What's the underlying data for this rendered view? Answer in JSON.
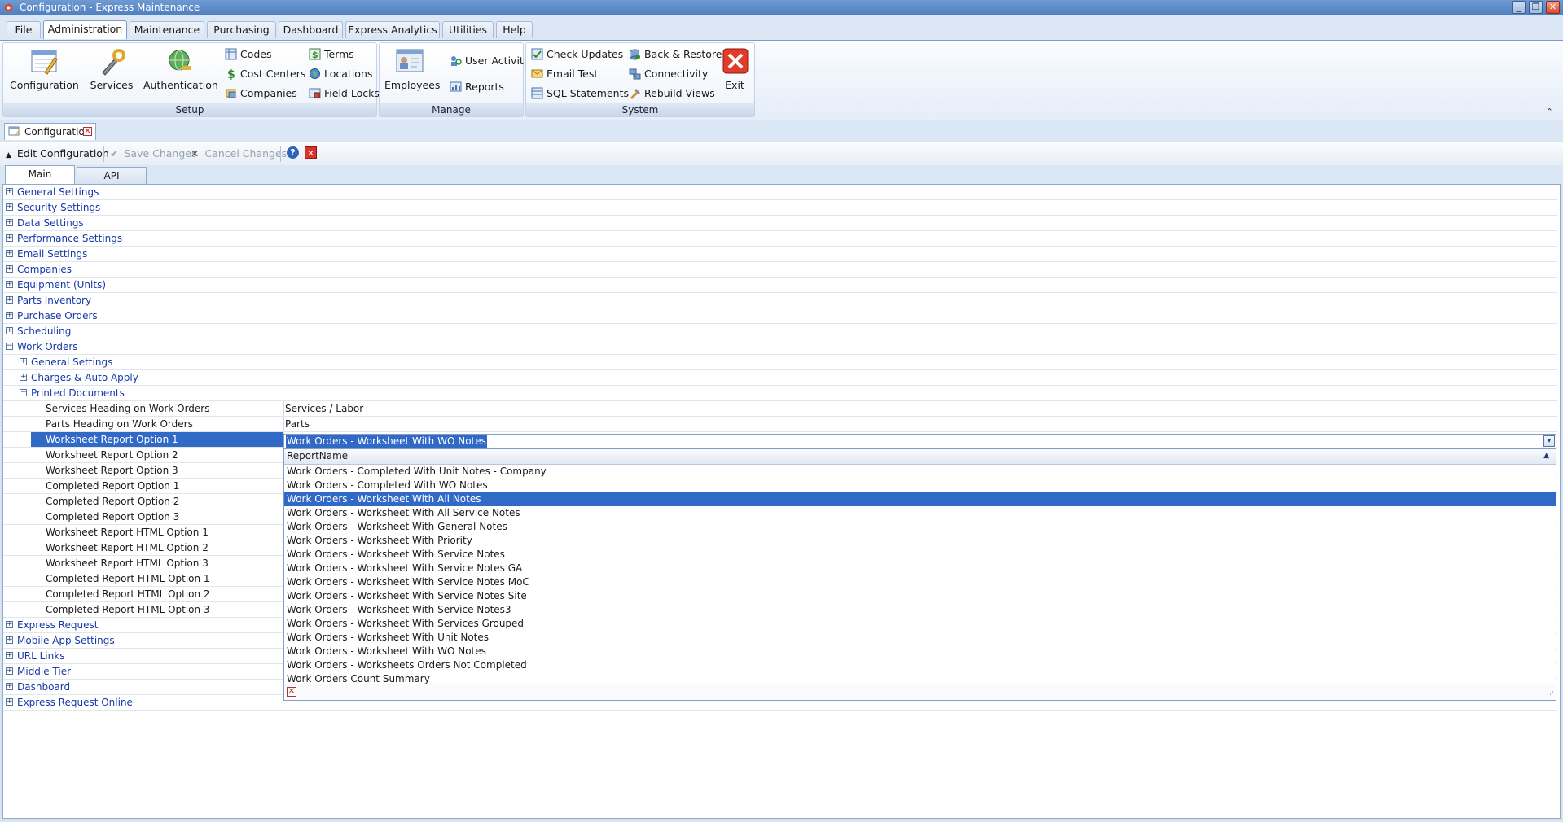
{
  "window": {
    "title": "Configuration - Express Maintenance",
    "minimize_glyph": "_",
    "restore_glyph": "❐",
    "close_glyph": "✕"
  },
  "menu_tabs": [
    "File",
    "Administration",
    "Maintenance",
    "Purchasing",
    "Dashboard",
    "Express Analytics",
    "Utilities",
    "Help"
  ],
  "active_menu_tab": "Administration",
  "ribbon": {
    "setup": {
      "label": "Setup",
      "configuration": "Configuration",
      "services": "Services",
      "authentication": "Authentication",
      "codes": "Codes",
      "cost_centers": "Cost Centers",
      "companies": "Companies",
      "terms": "Terms",
      "locations": "Locations",
      "field_locks": "Field Locks"
    },
    "manage": {
      "label": "Manage",
      "employees": "Employees",
      "user_activity": "User Activity",
      "reports": "Reports"
    },
    "system": {
      "label": "System",
      "check_updates": "Check Updates",
      "email_test": "Email Test",
      "sql_statements": "SQL Statements",
      "back_restore": "Back & Restore",
      "connectivity": "Connectivity",
      "rebuild_views": "Rebuild Views",
      "exit": "Exit"
    },
    "collapse_glyph": "⌃"
  },
  "document_tab": {
    "label": "Configuration",
    "close_glyph": "✕"
  },
  "toolbar": {
    "edit_configuration": "Edit Configuration",
    "save_changes": "Save Changes",
    "cancel_changes": "Cancel Changes",
    "edit_glyph": "▲",
    "save_glyph": "✔",
    "cancel_glyph": "✕",
    "help_glyph": "?",
    "close_glyph": "✕"
  },
  "inner_tabs": [
    "Main",
    "API"
  ],
  "active_inner_tab": "Main",
  "property_grid": {
    "categories_top": [
      "General Settings",
      "Security Settings",
      "Data Settings",
      "Performance Settings",
      "Email Settings",
      "Companies",
      "Equipment (Units)",
      "Parts Inventory",
      "Purchase Orders",
      "Scheduling"
    ],
    "expanded_category": "Work Orders",
    "subcategories": [
      "General Settings",
      "Charges & Auto Apply"
    ],
    "expanded_subcategory": "Printed Documents",
    "properties": [
      {
        "name": "Services Heading on Work Orders",
        "value": "Services / Labor"
      },
      {
        "name": "Parts Heading on Work Orders",
        "value": "Parts"
      },
      {
        "name": "Worksheet Report Option 1",
        "value": "Work Orders - Worksheet With WO Notes"
      },
      {
        "name": "Worksheet Report Option 2",
        "value": ""
      },
      {
        "name": "Worksheet Report Option 3",
        "value": ""
      },
      {
        "name": "Completed Report Option 1",
        "value": ""
      },
      {
        "name": "Completed Report Option 2",
        "value": ""
      },
      {
        "name": "Completed Report Option 3",
        "value": ""
      },
      {
        "name": "Worksheet Report HTML Option 1",
        "value": ""
      },
      {
        "name": "Worksheet Report HTML Option 2",
        "value": ""
      },
      {
        "name": "Worksheet Report HTML Option 3",
        "value": ""
      },
      {
        "name": "Completed Report HTML Option 1",
        "value": ""
      },
      {
        "name": "Completed Report HTML Option 2",
        "value": ""
      },
      {
        "name": "Completed Report HTML Option 3",
        "value": ""
      }
    ],
    "categories_bottom": [
      "Express Request",
      "Mobile App Settings",
      "URL Links",
      "Middle Tier",
      "Dashboard",
      "Express Request Online"
    ],
    "plus_glyph": "+",
    "minus_glyph": "−"
  },
  "editor": {
    "value": "Work Orders - Worksheet With WO Notes",
    "drop_glyph": "▾"
  },
  "dropdown": {
    "header": "ReportName",
    "sort_glyph": "▲",
    "items": [
      "Work Orders - Completed With Unit Notes - Company",
      "Work Orders - Completed With WO Notes",
      "Work Orders - Worksheet With All Notes",
      "Work Orders - Worksheet With All Service Notes",
      "Work Orders - Worksheet With General Notes",
      "Work Orders - Worksheet With Priority",
      "Work Orders - Worksheet With Service Notes",
      "Work Orders - Worksheet With Service Notes  GA",
      "Work Orders - Worksheet With Service Notes MoC",
      "Work Orders - Worksheet With Service Notes Site",
      "Work Orders - Worksheet With Service Notes3",
      "Work Orders - Worksheet With Services Grouped",
      "Work Orders - Worksheet With Unit Notes",
      "Work Orders - Worksheet With WO Notes",
      "Work Orders - Worksheets Orders Not Completed",
      "Work Orders Count Summary"
    ],
    "highlighted_item": "Work Orders - Worksheet With All Notes",
    "clear_glyph": "✕",
    "grip_glyph": "⋰"
  },
  "colors": {
    "selection": "#3169c6",
    "category_text": "#1539a8",
    "titlebar": "#4f7fc0"
  }
}
